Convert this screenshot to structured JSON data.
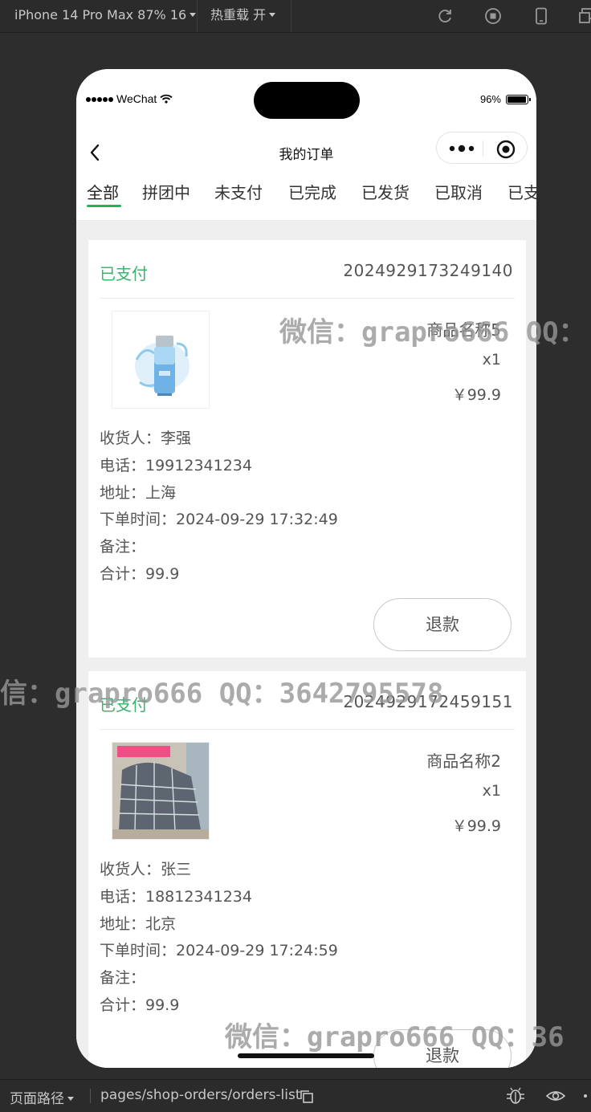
{
  "toolbar": {
    "device": "iPhone 14 Pro Max 87% 16",
    "hot_reload": "热重载 开"
  },
  "status_bar": {
    "carrier": "WeChat",
    "battery": "96%",
    "battery_level": 0.96
  },
  "nav": {
    "title": "我的订单"
  },
  "tabs": [
    "全部",
    "拼团中",
    "未支付",
    "已完成",
    "已发货",
    "已取消",
    "已支"
  ],
  "orders": [
    {
      "status": "已支付",
      "order_no": "2024929173249140",
      "product_name": "商品名称5",
      "qty": "x1",
      "price": "￥99.9",
      "image": "serum-bottle",
      "receiver": "收货人：李强",
      "phone": "电话：19912341234",
      "address": "地址：上海",
      "time": "下单时间：2024-09-29 17:32:49",
      "note": "备注：",
      "total": "合计：99.9",
      "action": "退款"
    },
    {
      "status": "已支付",
      "order_no": "2024929172459151",
      "product_name": "商品名称2",
      "qty": "x1",
      "price": "￥99.9",
      "image": "plaid-pillow",
      "receiver": "收货人：张三",
      "phone": "电话：18812341234",
      "address": "地址：北京",
      "time": "下单时间：2024-09-29 17:24:59",
      "note": "备注：",
      "total": "合计：99.9",
      "action": "退款"
    }
  ],
  "watermarks": [
    "微信：grapro666 QQ：",
    "信：grapro666 QQ：3642795578",
    "微信：grapro666 QQ：36"
  ],
  "bottom_bar": {
    "path_label": "页面路径",
    "path": "pages/shop-orders/orders-list"
  },
  "colors": {
    "accent": "#22b35e",
    "status_text": "#3cb46e",
    "toolbar_bg": "#2b2b2b"
  }
}
